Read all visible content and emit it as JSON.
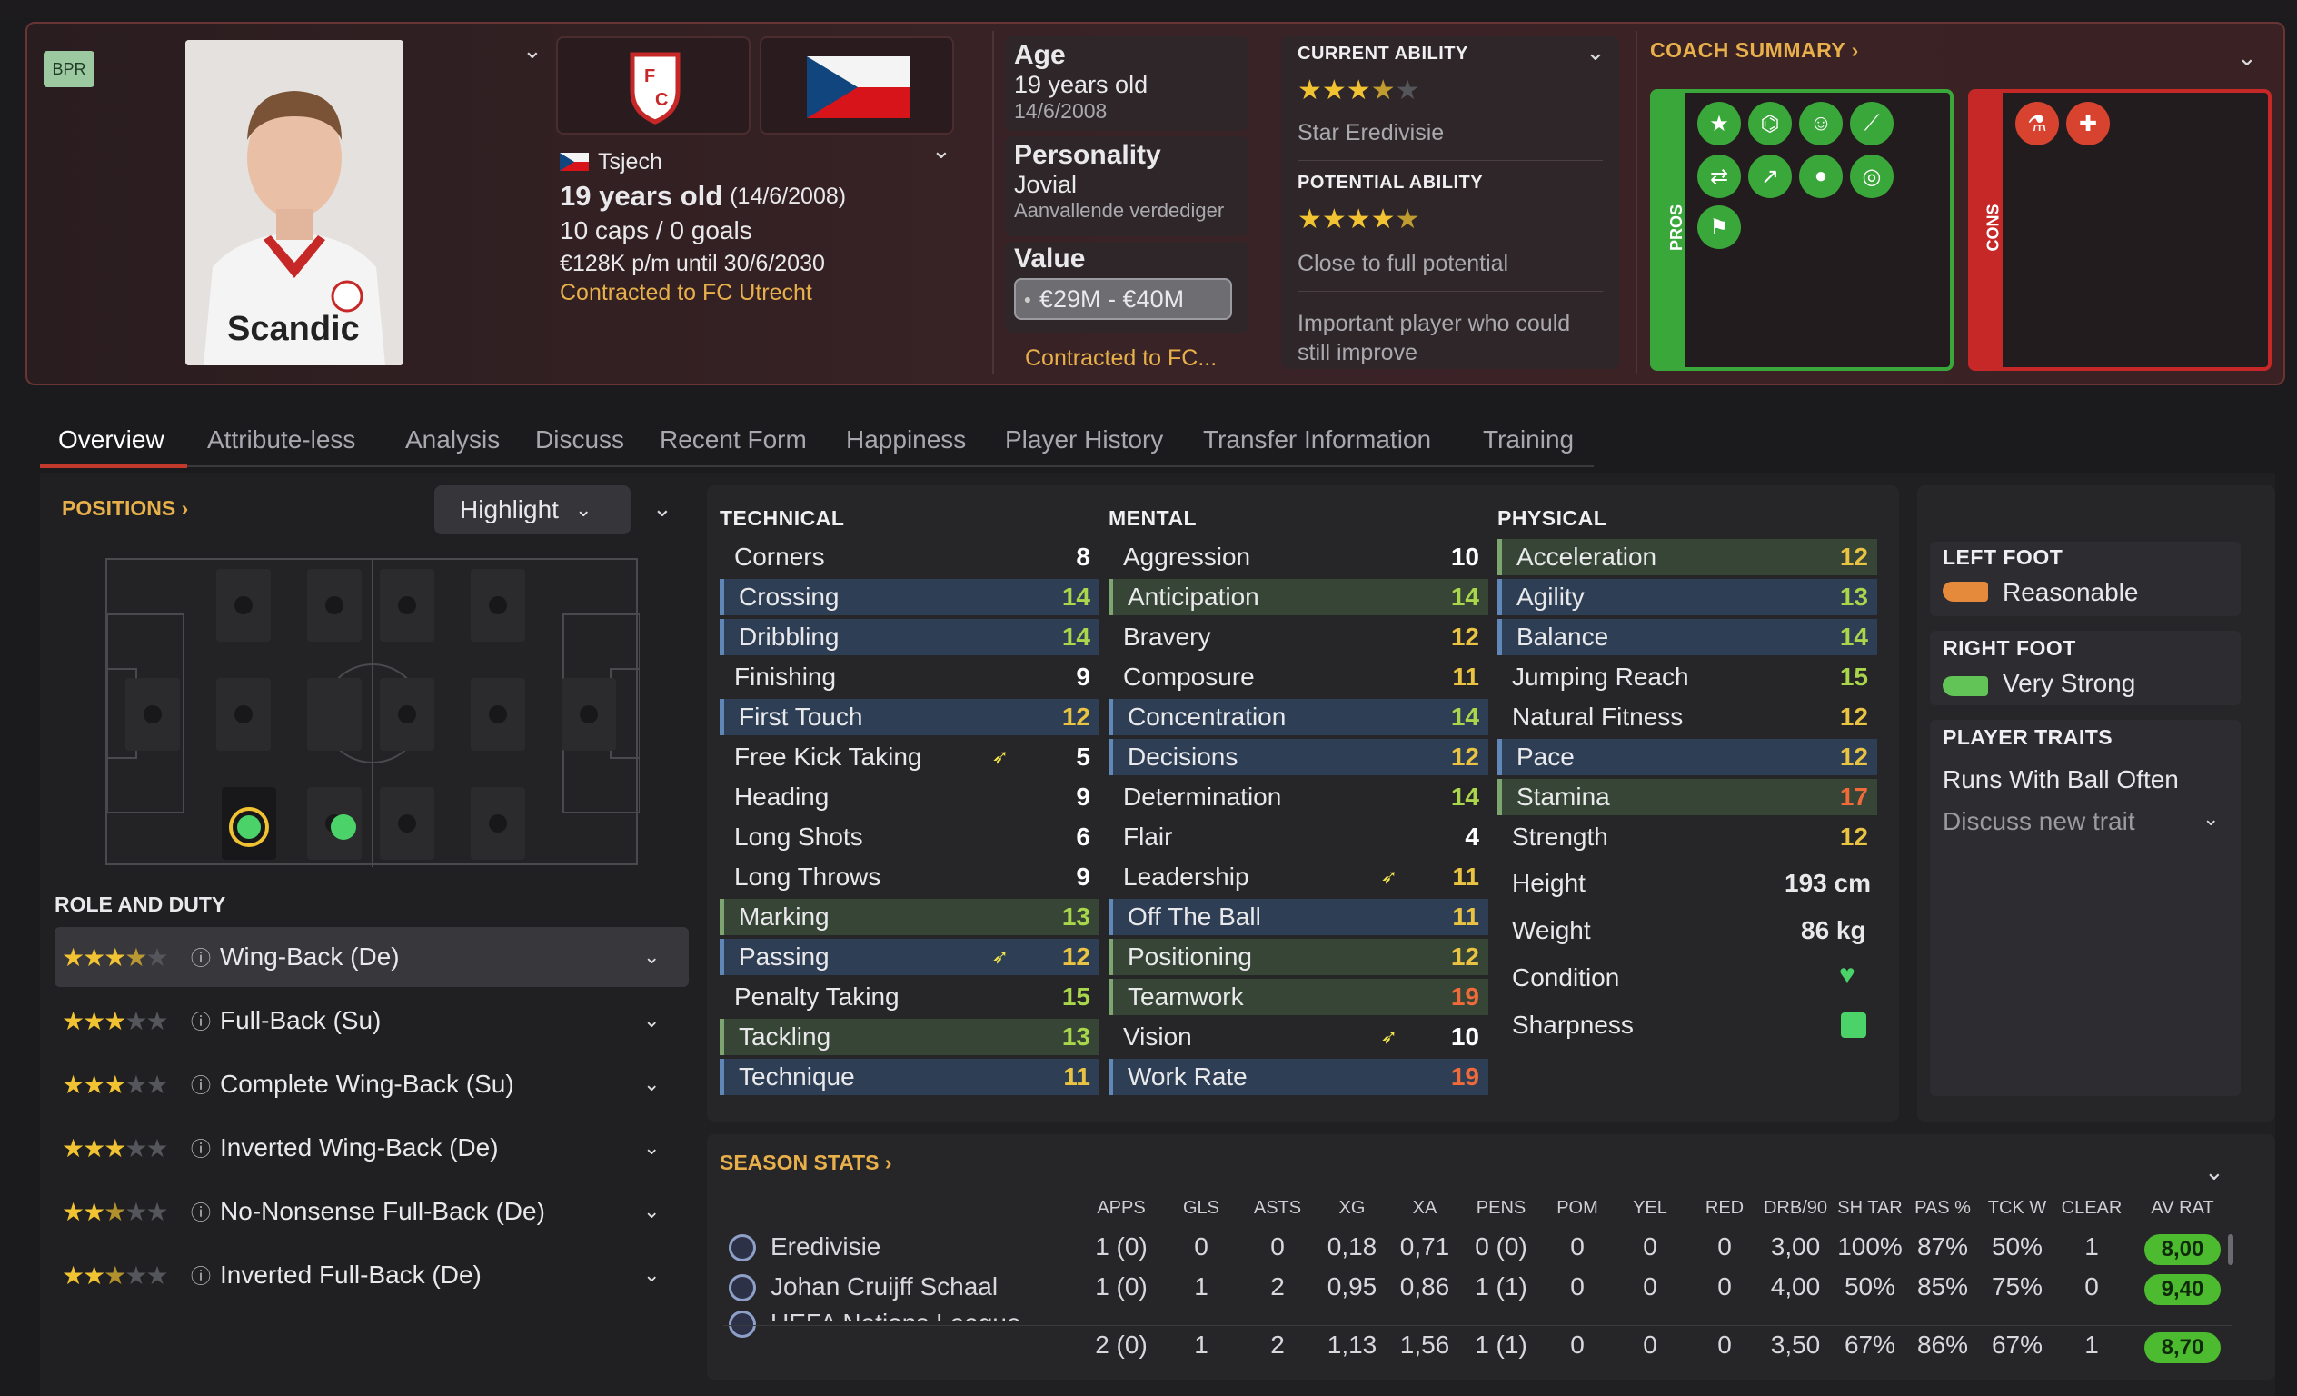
{
  "header": {
    "badge": "BPR",
    "nationality": "Tsjech",
    "age_line": "19 years old",
    "dob_paren": "(14/6/2008)",
    "caps": "10 caps / 0 goals",
    "wage": "€128K p/m until 30/6/2030",
    "contract": "Contracted to FC Utrecht",
    "club_crest_text": "FC UTRECHT",
    "shirt_sponsor": "Scandic"
  },
  "info": {
    "age_label": "Age",
    "age_value": "19 years old",
    "age_date": "14/6/2008",
    "personality_label": "Personality",
    "personality_value": "Jovial",
    "personality_sub": "Aanvallende verdediger",
    "value_label": "Value",
    "value_range": "€29M - €40M",
    "contract_short": "Contracted to FC..."
  },
  "ability": {
    "current_label": "CURRENT ABILITY",
    "current_stars": 3.5,
    "current_text": "Star Eredivisie",
    "potential_label": "POTENTIAL ABILITY",
    "potential_stars": 4.5,
    "potential_text": "Close to full potential",
    "note": "Important player who could still improve"
  },
  "coach": {
    "title": "COACH SUMMARY ›",
    "pros_label": "PROS",
    "cons_label": "CONS",
    "pros_icons": [
      "star-icon",
      "brain-icon",
      "team-icon",
      "ball-icon",
      "handshake-icon",
      "trend-icon",
      "head-icon",
      "target-icon",
      "flag-icon"
    ],
    "cons_icons": [
      "flask-icon",
      "injury-icon"
    ]
  },
  "tabs": [
    "Overview",
    "Attribute-less",
    "Analysis",
    "Discuss",
    "Recent Form",
    "Happiness",
    "Player History",
    "Transfer Information",
    "Training"
  ],
  "positions": {
    "title": "POSITIONS ›",
    "highlight_label": "Highlight",
    "role_title": "ROLE AND DUTY",
    "roles": [
      {
        "name": "Wing-Back (De)",
        "stars": 3.5
      },
      {
        "name": "Full-Back (Su)",
        "stars": 3
      },
      {
        "name": "Complete Wing-Back (Su)",
        "stars": 3
      },
      {
        "name": "Inverted Wing-Back (De)",
        "stars": 3
      },
      {
        "name": "No-Nonsense Full-Back (De)",
        "stars": 2.5
      },
      {
        "name": "Inverted Full-Back (De)",
        "stars": 2.5
      }
    ]
  },
  "attributes": {
    "technical_title": "TECHNICAL",
    "mental_title": "MENTAL",
    "physical_title": "PHYSICAL",
    "technical": [
      {
        "n": "Corners",
        "v": "8",
        "h": ""
      },
      {
        "n": "Crossing",
        "v": "14",
        "h": "blue"
      },
      {
        "n": "Dribbling",
        "v": "14",
        "h": "blue"
      },
      {
        "n": "Finishing",
        "v": "9",
        "h": ""
      },
      {
        "n": "First Touch",
        "v": "12",
        "h": "blue"
      },
      {
        "n": "Free Kick Taking",
        "v": "5",
        "h": "",
        "t": true
      },
      {
        "n": "Heading",
        "v": "9",
        "h": ""
      },
      {
        "n": "Long Shots",
        "v": "6",
        "h": ""
      },
      {
        "n": "Long Throws",
        "v": "9",
        "h": ""
      },
      {
        "n": "Marking",
        "v": "13",
        "h": "green"
      },
      {
        "n": "Passing",
        "v": "12",
        "h": "blue",
        "t": true
      },
      {
        "n": "Penalty Taking",
        "v": "15",
        "h": ""
      },
      {
        "n": "Tackling",
        "v": "13",
        "h": "green"
      },
      {
        "n": "Technique",
        "v": "11",
        "h": "blue"
      }
    ],
    "mental": [
      {
        "n": "Aggression",
        "v": "10",
        "h": ""
      },
      {
        "n": "Anticipation",
        "v": "14",
        "h": "green"
      },
      {
        "n": "Bravery",
        "v": "12",
        "h": ""
      },
      {
        "n": "Composure",
        "v": "11",
        "h": ""
      },
      {
        "n": "Concentration",
        "v": "14",
        "h": "blue"
      },
      {
        "n": "Decisions",
        "v": "12",
        "h": "blue"
      },
      {
        "n": "Determination",
        "v": "14",
        "h": ""
      },
      {
        "n": "Flair",
        "v": "4",
        "h": ""
      },
      {
        "n": "Leadership",
        "v": "11",
        "h": "",
        "t": true
      },
      {
        "n": "Off The Ball",
        "v": "11",
        "h": "blue"
      },
      {
        "n": "Positioning",
        "v": "12",
        "h": "green"
      },
      {
        "n": "Teamwork",
        "v": "19",
        "h": "green"
      },
      {
        "n": "Vision",
        "v": "10",
        "h": "",
        "t": true
      },
      {
        "n": "Work Rate",
        "v": "19",
        "h": "blue"
      }
    ],
    "physical": [
      {
        "n": "Acceleration",
        "v": "12",
        "h": "green"
      },
      {
        "n": "Agility",
        "v": "13",
        "h": "blue"
      },
      {
        "n": "Balance",
        "v": "14",
        "h": "blue"
      },
      {
        "n": "Jumping Reach",
        "v": "15",
        "h": ""
      },
      {
        "n": "Natural Fitness",
        "v": "12",
        "h": ""
      },
      {
        "n": "Pace",
        "v": "12",
        "h": "blue"
      },
      {
        "n": "Stamina",
        "v": "17",
        "h": "green"
      },
      {
        "n": "Strength",
        "v": "12",
        "h": ""
      }
    ],
    "height_label": "Height",
    "height_value": "193 cm",
    "weight_label": "Weight",
    "weight_value": "86 kg",
    "condition_label": "Condition",
    "sharpness_label": "Sharpness"
  },
  "feet": {
    "left_label": "LEFT FOOT",
    "left_value": "Reasonable",
    "right_label": "RIGHT FOOT",
    "right_value": "Very Strong",
    "traits_label": "PLAYER TRAITS",
    "trait": "Runs With Ball Often",
    "discuss": "Discuss new trait"
  },
  "season": {
    "title": "SEASON STATS ›",
    "columns": [
      "APPS",
      "GLS",
      "ASTS",
      "XG",
      "XA",
      "PENS",
      "POM",
      "YEL",
      "RED",
      "DRB/90",
      "SH TAR",
      "PAS %",
      "TCK W",
      "CLEAR",
      "AV RAT"
    ],
    "rows": [
      {
        "comp": "Eredivisie",
        "vals": [
          "1 (0)",
          "0",
          "0",
          "0,18",
          "0,71",
          "0 (0)",
          "0",
          "0",
          "0",
          "3,00",
          "100%",
          "87%",
          "50%",
          "1"
        ],
        "rating": "8,00"
      },
      {
        "comp": "Johan Cruijff Schaal",
        "vals": [
          "1 (0)",
          "1",
          "2",
          "0,95",
          "0,86",
          "1 (1)",
          "0",
          "0",
          "0",
          "4,00",
          "50%",
          "85%",
          "75%",
          "0"
        ],
        "rating": "9,40"
      },
      {
        "comp": "UEFA Nations League",
        "vals": []
      }
    ],
    "total": {
      "vals": [
        "2 (0)",
        "1",
        "2",
        "1,13",
        "1,56",
        "1 (1)",
        "0",
        "0",
        "0",
        "3,50",
        "67%",
        "86%",
        "67%",
        "1"
      ],
      "rating": "8,70"
    }
  },
  "colors": {
    "accent": "#e8b04a",
    "pros": "#3aa73a",
    "cons": "#c62828",
    "rating": "#4cbb2f"
  }
}
